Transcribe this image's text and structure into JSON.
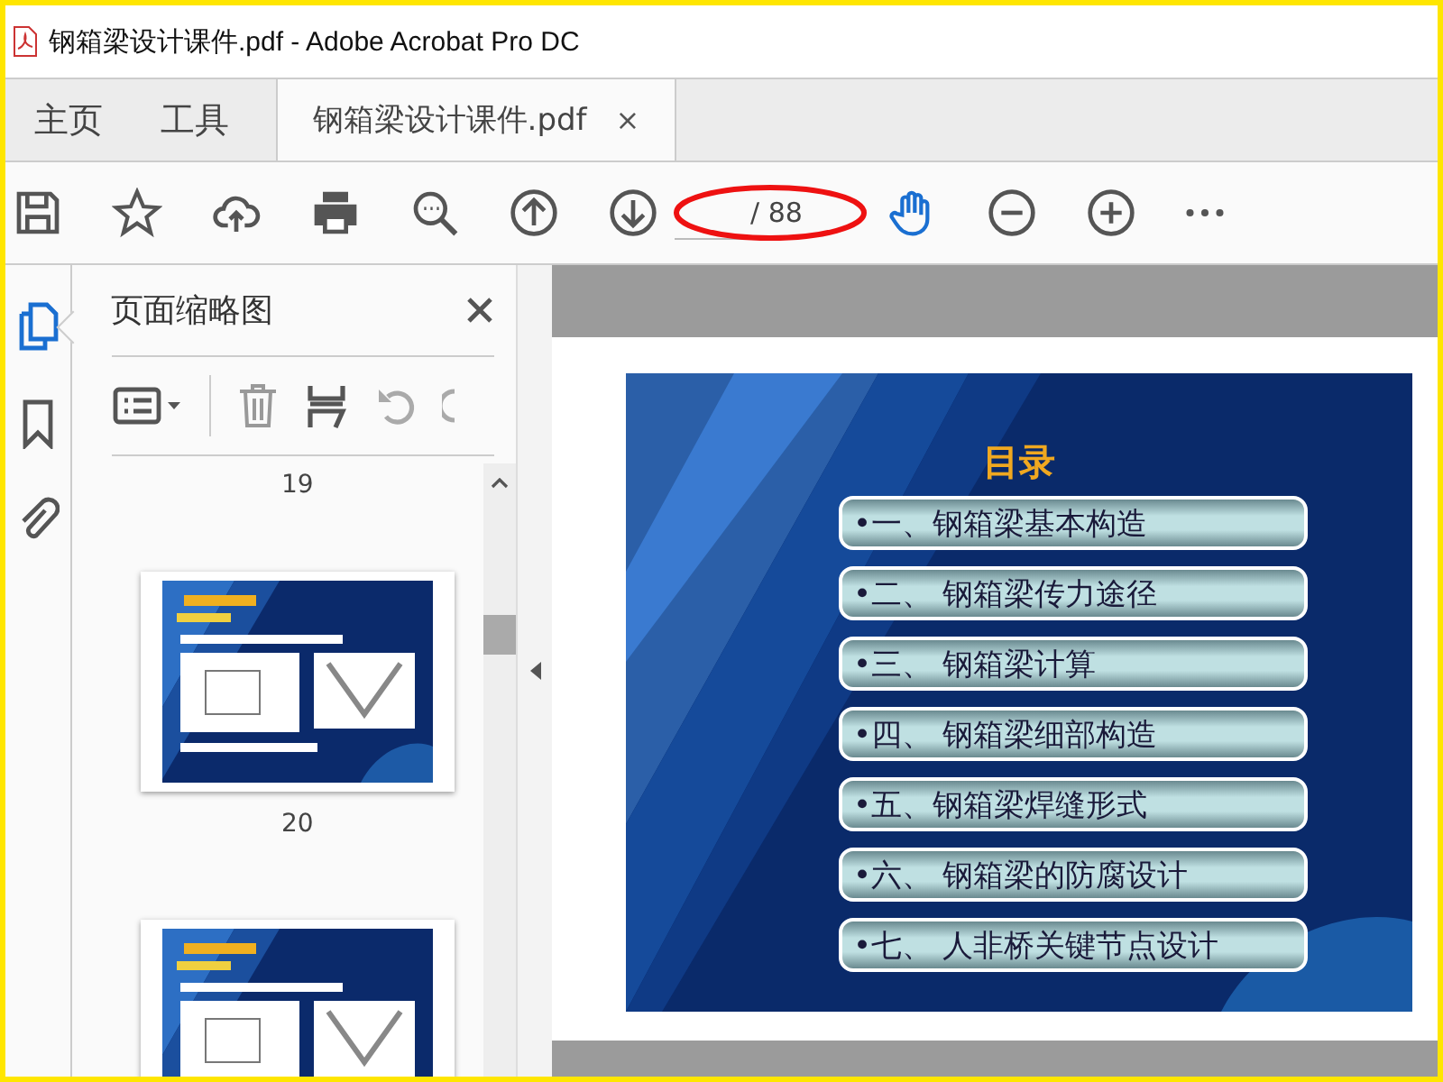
{
  "window": {
    "title": "钢箱梁设计课件.pdf - Adobe Acrobat Pro DC"
  },
  "tabs": [
    {
      "label": "主页",
      "kind": "nav",
      "selected": false
    },
    {
      "label": "工具",
      "kind": "nav",
      "selected": false
    },
    {
      "label": "钢箱梁设计课件.pdf",
      "kind": "doc",
      "selected": true,
      "close": "×"
    }
  ],
  "page_nav": {
    "total": "/ 88"
  },
  "sidebar": {
    "items": [
      {
        "kind": "pages",
        "selected": true
      },
      {
        "kind": "bookmark",
        "selected": false
      },
      {
        "kind": "attach",
        "selected": false
      }
    ]
  },
  "panel": {
    "title": "页面缩略图",
    "thumbnails": [
      {
        "kind": "label",
        "label": "19"
      },
      {
        "kind": "page",
        "label": "20"
      },
      {
        "kind": "page"
      }
    ]
  },
  "slide": {
    "title": "目录",
    "items": [
      "•一、钢箱梁基本构造",
      "•二、 钢箱梁传力途径",
      "•三、 钢箱梁计算",
      "•四、 钢箱梁细部构造",
      "•五、钢箱梁焊缝形式",
      "•六、 钢箱梁的防腐设计",
      "•七、 人非桥关键节点设计"
    ]
  }
}
